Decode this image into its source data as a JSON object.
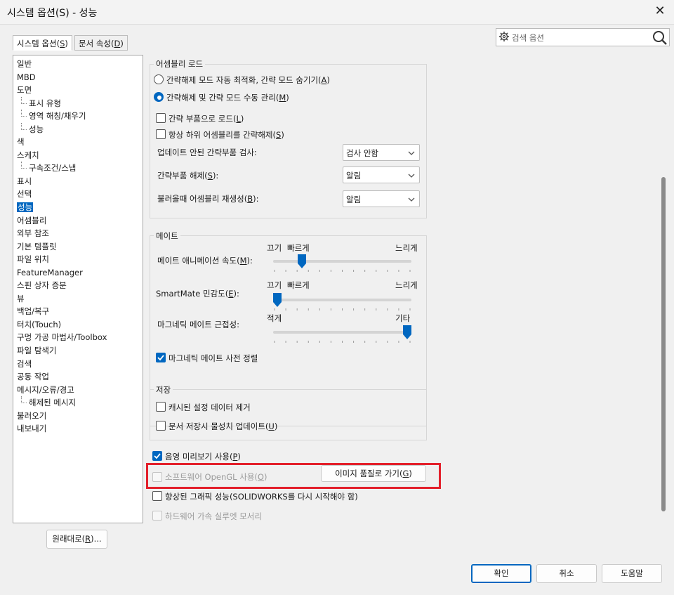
{
  "window": {
    "title": "시스템 옵션(S) - 성능",
    "close_label": "✕"
  },
  "search": {
    "placeholder": "검색 옵션"
  },
  "tabs": [
    {
      "label": "시스템 옵션",
      "hotkey": "S"
    },
    {
      "label": "문서 속성",
      "hotkey": "D"
    }
  ],
  "tree": [
    {
      "label": "일반",
      "child": false
    },
    {
      "label": "MBD",
      "child": false
    },
    {
      "label": "도면",
      "child": false
    },
    {
      "label": "표시 유형",
      "child": true
    },
    {
      "label": "영역 해칭/채우기",
      "child": true
    },
    {
      "label": "성능",
      "child": true
    },
    {
      "label": "색",
      "child": false
    },
    {
      "label": "스케치",
      "child": false
    },
    {
      "label": "구속조건/스냅",
      "child": true
    },
    {
      "label": "표시",
      "child": false
    },
    {
      "label": "선택",
      "child": false
    },
    {
      "label": "성능",
      "child": false,
      "selected": true
    },
    {
      "label": "어셈블리",
      "child": false
    },
    {
      "label": "외부 참조",
      "child": false
    },
    {
      "label": "기본 템플릿",
      "child": false
    },
    {
      "label": "파일 위치",
      "child": false
    },
    {
      "label": "FeatureManager",
      "child": false
    },
    {
      "label": "스핀 상자 증분",
      "child": false
    },
    {
      "label": "뷰",
      "child": false
    },
    {
      "label": "백업/복구",
      "child": false
    },
    {
      "label": "터치(Touch)",
      "child": false
    },
    {
      "label": "구멍 가공 마법사/Toolbox",
      "child": false
    },
    {
      "label": "파일 탐색기",
      "child": false
    },
    {
      "label": "검색",
      "child": false
    },
    {
      "label": "공동 작업",
      "child": false
    },
    {
      "label": "메시지/오류/경고",
      "child": false
    },
    {
      "label": "해제된 메시지",
      "child": true
    },
    {
      "label": "불러오기",
      "child": false
    },
    {
      "label": "내보내기",
      "child": false
    }
  ],
  "reset_button": {
    "label": "원래대로(",
    "hotkey": "R",
    "suffix": ")..."
  },
  "assembly_load": {
    "title": "어셈블리 로드",
    "radio1": {
      "label": "간략해제 모드 자동 최적화, 간략 모드 숨기기(",
      "hotkey": "A",
      "suffix": ")",
      "checked": false
    },
    "radio2": {
      "label": "간략해제 및 간략 모드 수동 관리(",
      "hotkey": "M",
      "suffix": ")",
      "checked": true
    },
    "check1": {
      "label": "간략 부품으로 로드(",
      "hotkey": "L",
      "suffix": ")",
      "checked": false
    },
    "check2": {
      "label": "항상 하위 어셈블리를 간략해제(",
      "hotkey": "S",
      "suffix": ")",
      "checked": false
    },
    "row1": {
      "label": "업데이트 안된 간략부품 검사:",
      "value": "검사 안함"
    },
    "row2": {
      "label": "간략부품 해제(",
      "hotkey": "S",
      "suffix": "):",
      "value": "알림"
    },
    "row3": {
      "label": "불러올때 어셈블리 재생성(",
      "hotkey": "B",
      "suffix": "):",
      "value": "알림"
    }
  },
  "mate": {
    "title": "메이트",
    "anim": {
      "label": "메이트 애니메이션 속도(",
      "hotkey": "M",
      "suffix": "):",
      "left": "끄기",
      "mid": "빠르게",
      "right": "느리게",
      "level": 0.19
    },
    "smart": {
      "label": "SmartMate 민감도(",
      "hotkey": "E",
      "suffix": "):",
      "left": "끄기",
      "mid": "빠르게",
      "right": "느리게",
      "level": 0.0
    },
    "magnetic": {
      "label": "마그네틱 메이트 근접성:",
      "left": "적게",
      "right": "기타",
      "level": 1.0
    },
    "prealign": {
      "label": "마그네틱 메이트 사전 정렬",
      "checked": true
    }
  },
  "save": {
    "title": "저장",
    "check1": {
      "label": "캐시된 설정 데이터 제거",
      "checked": false
    },
    "check2": {
      "label": "문서 저장시 물성치 업데이트(",
      "hotkey": "U",
      "suffix": ")",
      "checked": false
    }
  },
  "misc": {
    "shadow": {
      "label": "음영 미리보기 사용(",
      "hotkey": "P",
      "suffix": ")",
      "checked": true
    },
    "opengl": {
      "label": "소프트웨어 OpenGL 사용(",
      "hotkey": "O",
      "suffix": ")",
      "checked": false,
      "disabled": true
    },
    "image_quality_button": {
      "label": "이미지 품질로 가기(",
      "hotkey": "G",
      "suffix": ")"
    },
    "enhanced": {
      "label": "향상된 그래픽 성능(SOLIDWORKS를 다시 시작해야 함)",
      "checked": false
    },
    "hw_silhouette": {
      "label": "하드웨어 가속 실루엣 모서리",
      "checked": false,
      "disabled": true
    }
  },
  "footer": {
    "ok": "확인",
    "cancel": "취소",
    "help": "도움말"
  },
  "colors": {
    "accent": "#0067c0",
    "highlight": "#e3202b"
  }
}
